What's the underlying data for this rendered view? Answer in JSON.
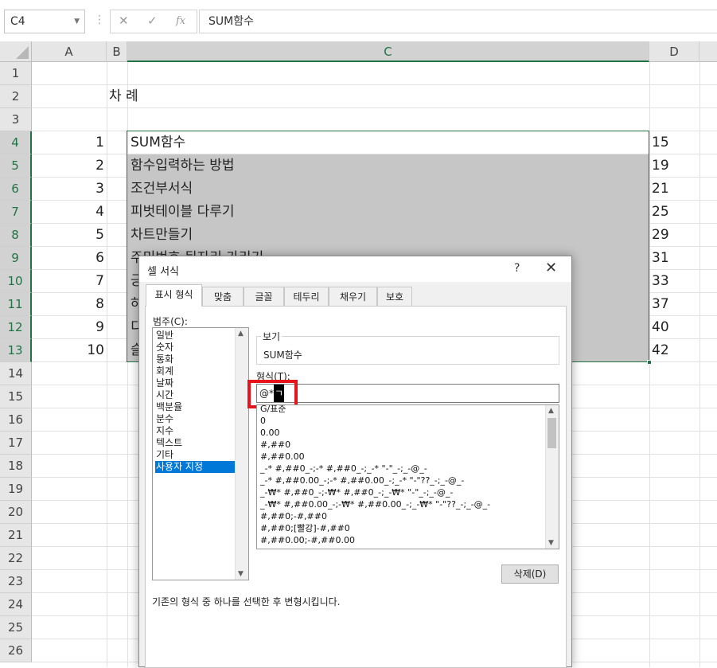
{
  "name_box": "C4",
  "formula_value": "SUM함수",
  "formula_icons": {
    "cancel": "✕",
    "enter": "✓",
    "fx": "fx"
  },
  "columns": [
    "A",
    "B",
    "C",
    "D"
  ],
  "rows": [
    "1",
    "2",
    "3",
    "4",
    "5",
    "6",
    "7",
    "8",
    "9",
    "10",
    "11",
    "12",
    "13",
    "14",
    "15",
    "16",
    "17",
    "18",
    "19",
    "20",
    "21",
    "22",
    "23",
    "24",
    "25",
    "26"
  ],
  "cells": {
    "B2": "차      례",
    "toc": [
      {
        "num": "1",
        "title": "SUM함수",
        "page": "15"
      },
      {
        "num": "2",
        "title": "함수입력하는 방법",
        "page": "19"
      },
      {
        "num": "3",
        "title": "조건부서식",
        "page": "21"
      },
      {
        "num": "4",
        "title": "피벗테이블 다루기",
        "page": "25"
      },
      {
        "num": "5",
        "title": "차트만들기",
        "page": "29"
      },
      {
        "num": "6",
        "title": "주민번호 뒷자리 가리기",
        "page": "31"
      },
      {
        "num": "7",
        "title": "긍",
        "page": "33"
      },
      {
        "num": "8",
        "title": "하",
        "page": "37"
      },
      {
        "num": "9",
        "title": "디",
        "page": "40"
      },
      {
        "num": "10",
        "title": "슬",
        "page": "42"
      }
    ]
  },
  "colors": {
    "accent": "#217346",
    "selected_item": "#0078d7",
    "highlight": "#e8141c",
    "selection_fill": "#c6c6c6"
  },
  "dialog": {
    "title": "셀 서식",
    "help": "?",
    "close": "✕",
    "tabs": [
      "표시 형식",
      "맞춤",
      "글꼴",
      "테두리",
      "채우기",
      "보호"
    ],
    "active_tab": "표시 형식",
    "category_label": "범주(C):",
    "categories": [
      "일반",
      "숫자",
      "통화",
      "회계",
      "날짜",
      "시간",
      "백분율",
      "분수",
      "지수",
      "텍스트",
      "기타",
      "사용자 지정"
    ],
    "selected_category": "사용자 지정",
    "sample_label": "보기",
    "sample_value": "SUM함수",
    "type_label": "형식(T):",
    "type_value": "@*",
    "type_caret": "ㄱ",
    "formats": [
      "G/표준",
      "0",
      "0.00",
      "#,##0",
      "#,##0.00",
      "_-* #,##0_-;-* #,##0_-;_-* \"-\"_-;_-@_-",
      "_-* #,##0.00_-;-* #,##0.00_-;_-* \"-\"??_-;_-@_-",
      "_-₩* #,##0_-;-₩* #,##0_-;_-₩* \"-\"_-;_-@_-",
      "_-₩* #,##0.00_-;-₩* #,##0.00_-;_-₩* \"-\"??_-;_-@_-",
      "#,##0;-#,##0",
      "#,##0;[빨강]-#,##0",
      "#,##0.00;-#,##0.00"
    ],
    "delete_button": "삭제(D)",
    "description": "기존의 형식 중 하나를 선택한 후 변형시킵니다."
  }
}
